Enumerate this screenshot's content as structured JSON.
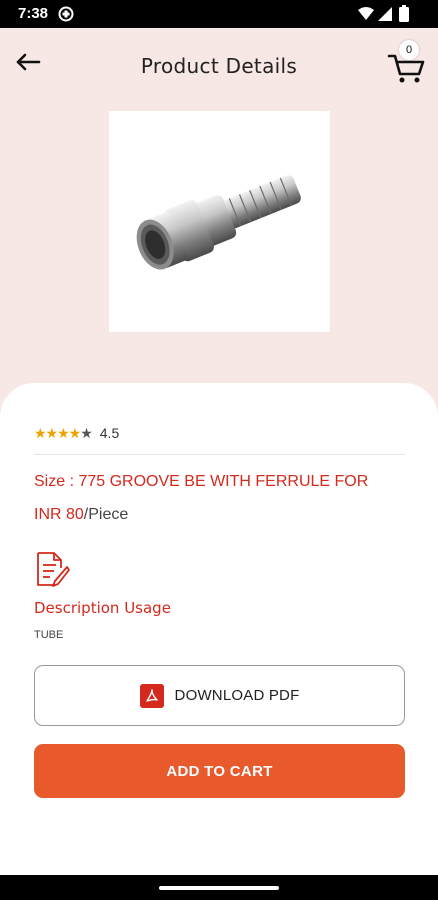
{
  "status_bar": {
    "time": "7:38"
  },
  "header": {
    "title": "Product Details",
    "cart_count": "0"
  },
  "product": {
    "rating_stars": "★★★★",
    "rating_half_star": "★",
    "rating_value": "4.5",
    "size": "Size : 775 GROOVE BE WITH FERRULE FOR",
    "price_amount": "INR 80",
    "price_unit": "/Piece",
    "description_heading": "Description Usage",
    "description_text": "TUBE"
  },
  "actions": {
    "download_pdf_label": "DOWNLOAD PDF",
    "add_to_cart_label": "ADD TO CART"
  },
  "colors": {
    "accent_red": "#d4291d",
    "button_orange": "#e85a2c",
    "header_background": "#f7e7e5",
    "star_gold": "#e9a400"
  },
  "icons": {
    "back": "arrow-left-icon",
    "cart": "shopping-cart-icon",
    "description": "document-edit-icon",
    "pdf": "pdf-file-icon"
  }
}
